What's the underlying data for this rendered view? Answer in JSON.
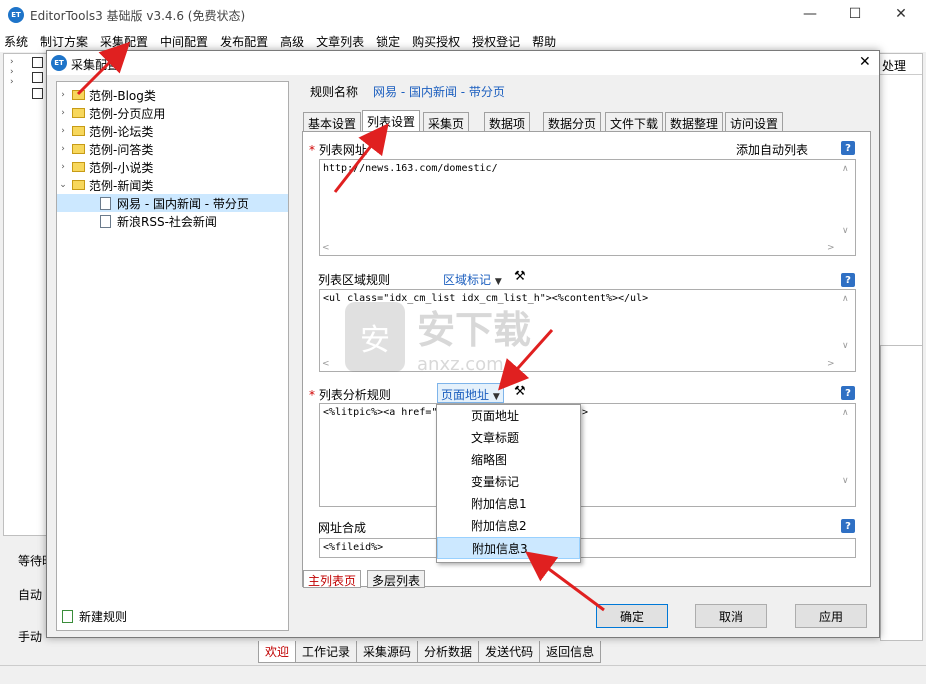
{
  "app": {
    "title": "EditorTools3 基础版 v3.4.6 (免费状态)",
    "logo": "ET"
  },
  "window_controls": {
    "minimize": "—",
    "maximize": "☐",
    "close": "✕"
  },
  "menu": [
    "系统",
    "制订方案",
    "采集配置",
    "中间配置",
    "发布配置",
    "高级",
    "文章列表",
    "锁定",
    "购买授权",
    "授权登记",
    "帮助"
  ],
  "main": {
    "col_header": "处理",
    "left_labels": [
      "等待时",
      "自动",
      "手动"
    ],
    "bottom_tabs": [
      "欢迎",
      "工作记录",
      "采集源码",
      "分析数据",
      "发送代码",
      "返回信息"
    ]
  },
  "dialog": {
    "title": "采集配置",
    "close": "✕",
    "tree": [
      {
        "label": "范例-Blog类",
        "arrow": "›"
      },
      {
        "label": "范例-分页应用",
        "arrow": "›"
      },
      {
        "label": "范例-论坛类",
        "arrow": "›"
      },
      {
        "label": "范例-问答类",
        "arrow": "›"
      },
      {
        "label": "范例-小说类",
        "arrow": "›"
      },
      {
        "label": "范例-新闻类",
        "arrow": "⌄"
      }
    ],
    "tree_children": [
      "网易 - 国内新闻 - 带分页",
      "新浪RSS-社会新闻"
    ],
    "new_rule": "新建规则",
    "rule_name_label": "规则名称",
    "rule_name": "网易 - 国内新闻 - 带分页",
    "tabs": [
      "基本设置",
      "列表设置",
      "采集页",
      "数据项",
      "数据分页",
      "文件下载",
      "数据整理",
      "访问设置"
    ],
    "list_url_label": "列表网址",
    "add_auto_list": "添加自动列表",
    "list_url_value": "http://news.163.com/domestic/",
    "region_label": "列表区域规则",
    "region_mark": "区域标记",
    "region_value": "<ul class=\"idx_cm_list idx_cm_list_h\"><%content%></ul>",
    "analysis_label": "列表分析规则",
    "analysis_select": "页面地址",
    "analysis_value": "<%litpic%><a href=\"",
    "analysis_value_tail": ">",
    "url_compose_label": "网址合成",
    "url_compose_value": "<%fileid%>",
    "dropdown_options": [
      "页面地址",
      "文章标题",
      "缩略图",
      "变量标记",
      "附加信息1",
      "附加信息2",
      "附加信息3"
    ],
    "dropdown_highlight": "附加信息3",
    "sub_tabs": [
      "主列表页",
      "多层列表"
    ],
    "buttons": {
      "ok": "确定",
      "cancel": "取消",
      "apply": "应用"
    },
    "help": "?",
    "required": "*"
  },
  "watermark": {
    "text": "安下载",
    "sub": "anxz.com"
  },
  "colors": {
    "accent": "#1e74c9",
    "annotation_arrow": "#e02020",
    "highlight": "#cce8ff"
  }
}
